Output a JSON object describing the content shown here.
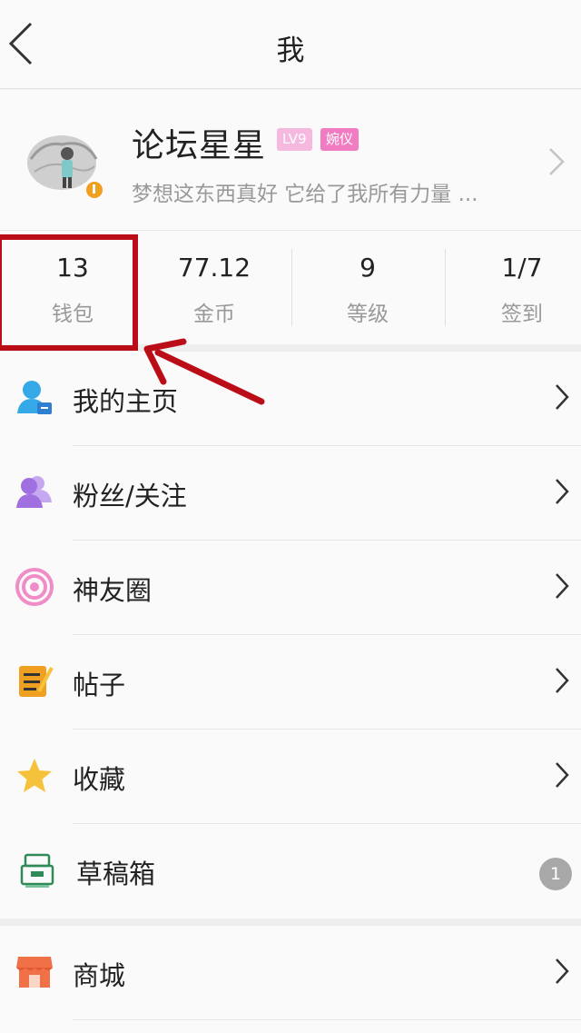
{
  "header": {
    "title": "我"
  },
  "profile": {
    "username": "论坛星星",
    "level_badge": "LV9",
    "title_badge": "婉仪",
    "signature": "梦想这东西真好 它给了我所有力量 ..."
  },
  "stats": [
    {
      "value": "13",
      "label": "钱包"
    },
    {
      "value": "77.12",
      "label": "金币"
    },
    {
      "value": "9",
      "label": "等级"
    },
    {
      "value": "1/7",
      "label": "签到"
    }
  ],
  "menu": {
    "homepage": "我的主页",
    "fans": "粉丝/关注",
    "circle": "神友圈",
    "posts": "帖子",
    "favorites": "收藏",
    "drafts": "草稿箱",
    "drafts_count": "1",
    "store": "商城"
  },
  "colors": {
    "annotation_red": "#bb0d17",
    "level_badge": "#f5b9e0",
    "title_badge": "#f17cc2",
    "homepage_icon": "#35a9e8",
    "fans_icon": "#a070e0",
    "circle_icon": "#f08cc8",
    "posts_icon": "#f0a020",
    "favorites_icon": "#f7c23b",
    "drafts_icon": "#3aa860",
    "store_icon": "#f07048"
  },
  "icons": [
    "back-chevron-icon",
    "user-icon",
    "fans-icon",
    "circle-icon",
    "posts-icon",
    "star-icon",
    "drafts-box-icon",
    "store-icon",
    "chevron-right-icon"
  ]
}
